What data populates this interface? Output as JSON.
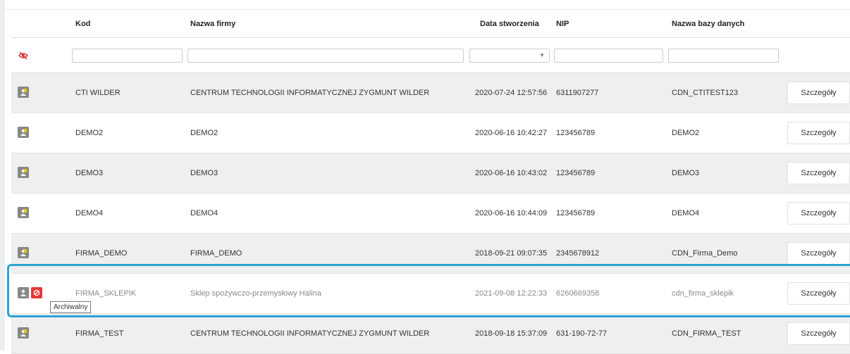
{
  "columns": {
    "kod": "Kod",
    "nazwa_firmy": "Nazwa firmy",
    "data_stworzenia": "Data stworzenia",
    "nip": "NIP",
    "nazwa_bazy": "Nazwa bazy danych"
  },
  "filters": {
    "kod": "",
    "nazwa_firmy": "",
    "data_stworzenia": "",
    "nip": "",
    "nazwa_bazy": ""
  },
  "icons": {
    "filter_toggle": "eye-off-icon",
    "company": "company-icon",
    "archived": "ban-icon"
  },
  "colors": {
    "row_grey": "#efefef",
    "highlight": "#29a3d4",
    "archived_badge": "#e53935",
    "company_badge": "#888888",
    "company_badge_accent": "#f1c40f"
  },
  "rows": [
    {
      "kod": "CTI WILDER",
      "nazwa_firmy": "CENTRUM TECHNOLOGII INFORMATYCZNEJ ZYGMUNT WILDER",
      "data_stworzenia": "2020-07-24 12:57:56",
      "nip": "6311907277",
      "nazwa_bazy": "CDN_CTITEST123",
      "action": "Szczegóły",
      "archived": false
    },
    {
      "kod": "DEMO2",
      "nazwa_firmy": "DEMO2",
      "data_stworzenia": "2020-06-16 10:42:27",
      "nip": "123456789",
      "nazwa_bazy": "DEMO2",
      "action": "Szczegóły",
      "archived": false
    },
    {
      "kod": "DEMO3",
      "nazwa_firmy": "DEMO3",
      "data_stworzenia": "2020-06-16 10:43:02",
      "nip": "123456789",
      "nazwa_bazy": "DEMO3",
      "action": "Szczegóły",
      "archived": false
    },
    {
      "kod": "DEMO4",
      "nazwa_firmy": "DEMO4",
      "data_stworzenia": "2020-06-16 10:44:09",
      "nip": "123456789",
      "nazwa_bazy": "DEMO4",
      "action": "Szczegóły",
      "archived": false
    },
    {
      "kod": "FIRMA_DEMO",
      "nazwa_firmy": "FIRMA_DEMO",
      "data_stworzenia": "2018-09-21 09:07:35",
      "nip": "2345678912",
      "nazwa_bazy": "CDN_Firma_Demo",
      "action": "Szczegóły",
      "archived": false
    },
    {
      "kod": "FIRMA_SKLEPIK",
      "nazwa_firmy": "Sklep spożywczo-przemysłowy Halina",
      "data_stworzenia": "2021-09-08 12:22:33",
      "nip": "6260669358",
      "nazwa_bazy": "cdn_firma_sklepik",
      "action": "Szczegóły",
      "archived": true
    },
    {
      "kod": "FIRMA_TEST",
      "nazwa_firmy": "CENTRUM TECHNOLOGII INFORMATYCZNEJ ZYGMUNT WILDER",
      "data_stworzenia": "2018-09-18 15:37:09",
      "nip": "631-190-72-77",
      "nazwa_bazy": "CDN_FIRMA_TEST",
      "action": "Szczegóły",
      "archived": false
    }
  ],
  "tooltip": "Archiwalny"
}
